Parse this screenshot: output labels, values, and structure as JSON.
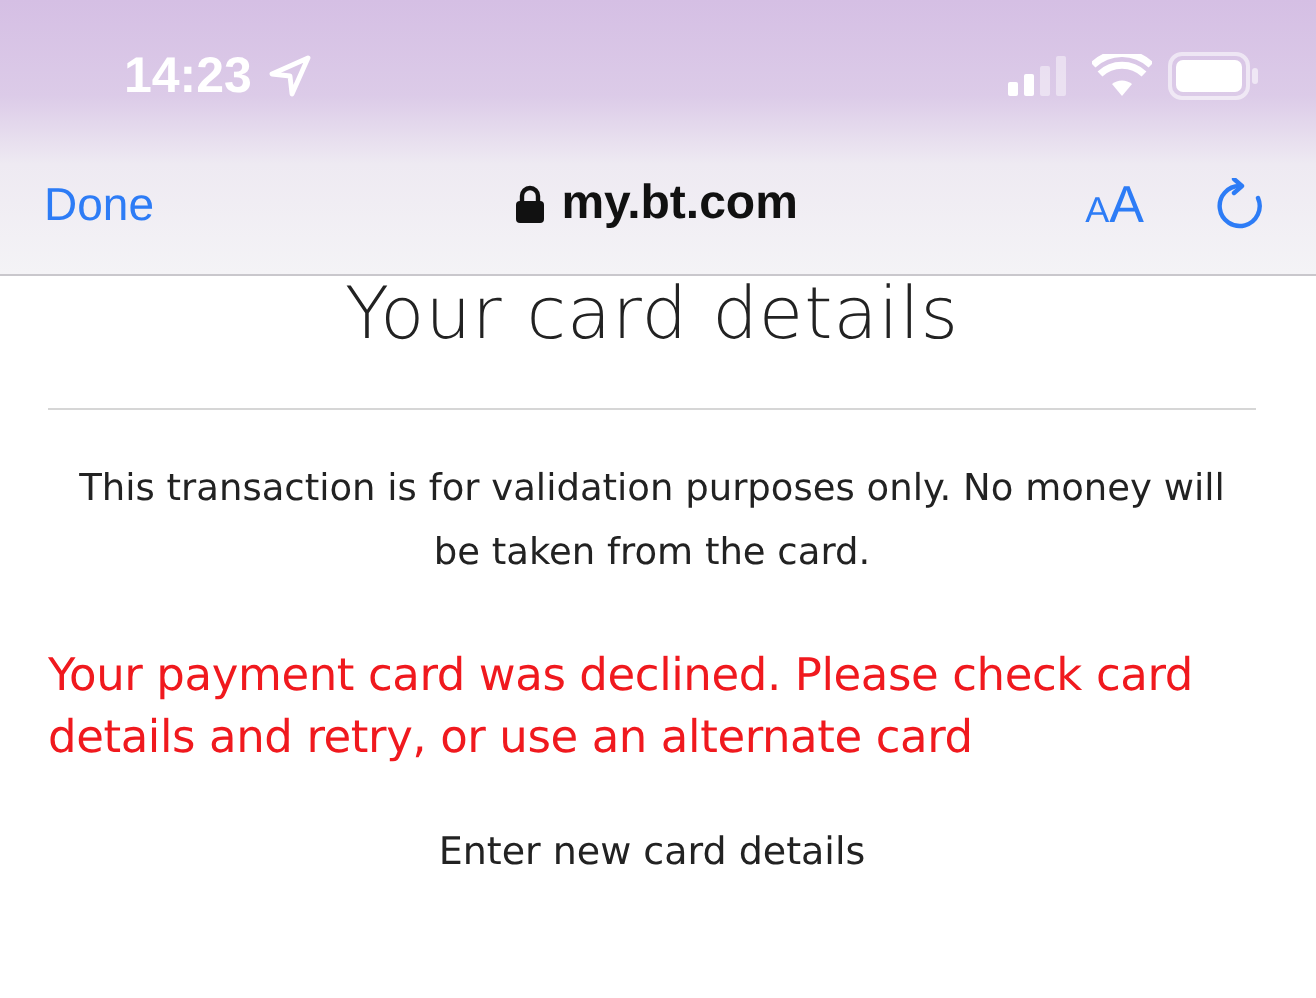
{
  "status_bar": {
    "time": "14:23"
  },
  "browser_bar": {
    "done": "Done",
    "url": "my.bt.com",
    "text_size": "AA"
  },
  "page": {
    "title": "Your card details",
    "info": "This transaction is for validation purposes only. No money will be taken from the card.",
    "error": "Your payment card was declined. Please check card details and retry, or use an alternate card",
    "link": "Enter new card details"
  }
}
